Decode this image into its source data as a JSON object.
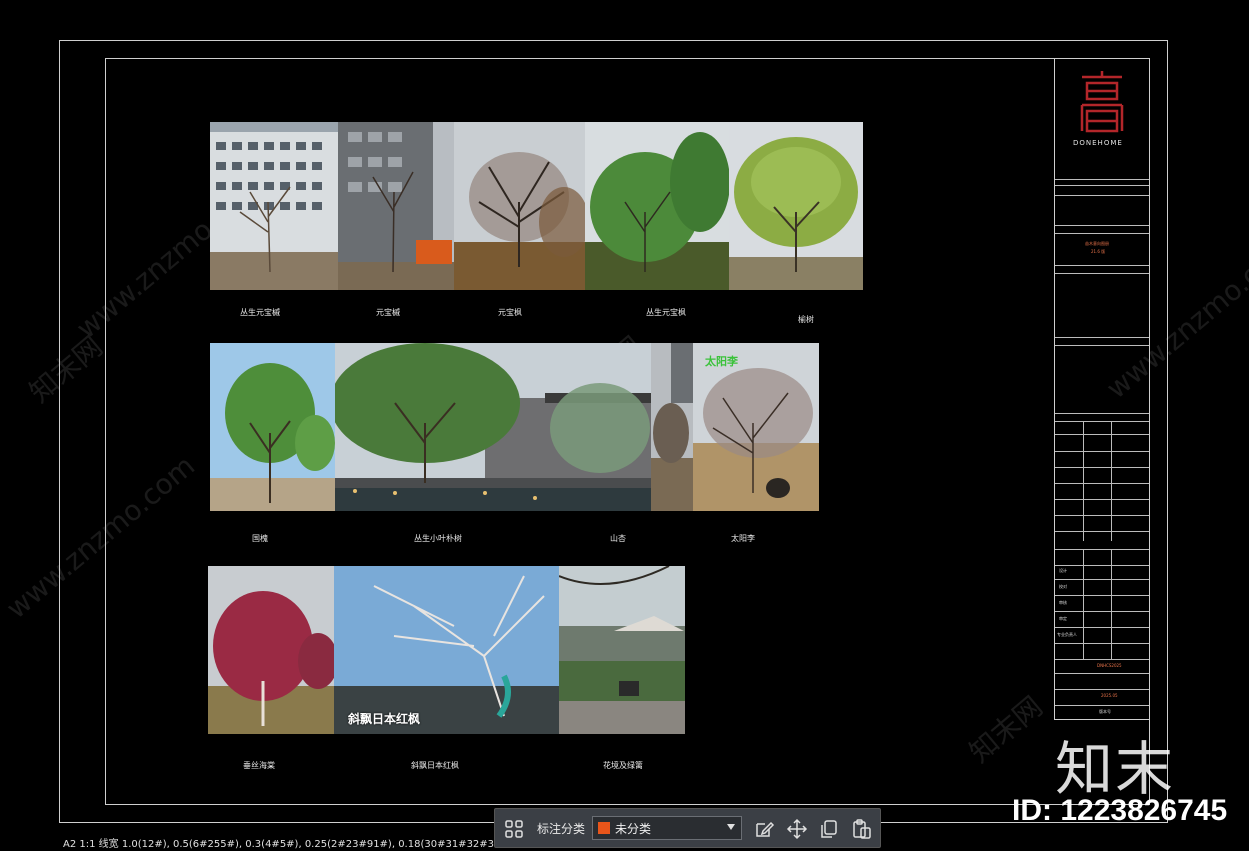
{
  "drawing": {
    "row1": [
      {
        "caption": "丛生元宝槭"
      },
      {
        "caption": "元宝槭"
      },
      {
        "caption": "元宝枫"
      },
      {
        "caption": "丛生元宝枫"
      },
      {
        "caption": "榆树"
      }
    ],
    "row2": [
      {
        "caption": "国槐"
      },
      {
        "caption": "丛生小叶朴树"
      },
      {
        "caption": "山杏"
      },
      {
        "caption": "太阳李"
      }
    ],
    "row2_overlay_label": "太阳李",
    "row3": [
      {
        "caption": "垂丝海棠"
      },
      {
        "caption": "斜飘日本红枫"
      },
      {
        "caption": "花境及绿篱"
      }
    ],
    "row3_overlay_label": "斜飘日本红枫"
  },
  "title_block": {
    "brand": "DONEHOME",
    "project_lines": [
      "苗木意向图册",
      "21.6 版"
    ],
    "fields": [
      "设计",
      "校对",
      "审核",
      "审定",
      "专业负责人"
    ],
    "sheet_no": "DNHCS2025",
    "date": "2025.05",
    "version": "版本号"
  },
  "toolbar": {
    "label": "标注分类",
    "select_value": "未分类",
    "select_color": "#e8551a"
  },
  "status": {
    "text": "A2  1:1  线宽    1.0(12#), 0.5(6#255#), 0.3(4#5#), 0.25(2#23#91#), 0.18(30#31#32#33#96#12"
  },
  "watermark": {
    "site": "www.znzmo.com",
    "cn": "知末网",
    "logo": "知末",
    "id": "ID: 1223826745"
  }
}
